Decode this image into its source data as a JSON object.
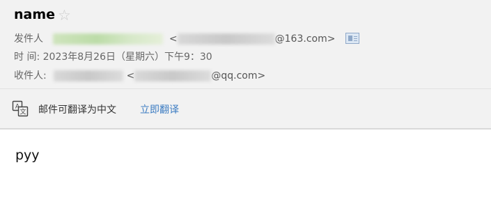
{
  "email": {
    "subject": "name",
    "from_label": "发件人",
    "from_addr_open": "<",
    "from_addr_visible": "@163.com>",
    "time_label": "时 间:",
    "time_value": "2023年8月26日（星期六）下午9：30",
    "to_label": "收件人:",
    "to_addr_open": "<",
    "to_addr_visible": "@qq.com>",
    "body_text": "pyy"
  },
  "translate": {
    "message": "邮件可翻译为中文",
    "link_label": "立即翻译"
  },
  "icons": {
    "star": "star-outline-icon",
    "contact_card": "contact-card-icon",
    "translate": "translate-icon"
  },
  "colors": {
    "header_bg": "#f2f2f2",
    "link": "#3c7cc2",
    "star": "#c9c9c9"
  }
}
